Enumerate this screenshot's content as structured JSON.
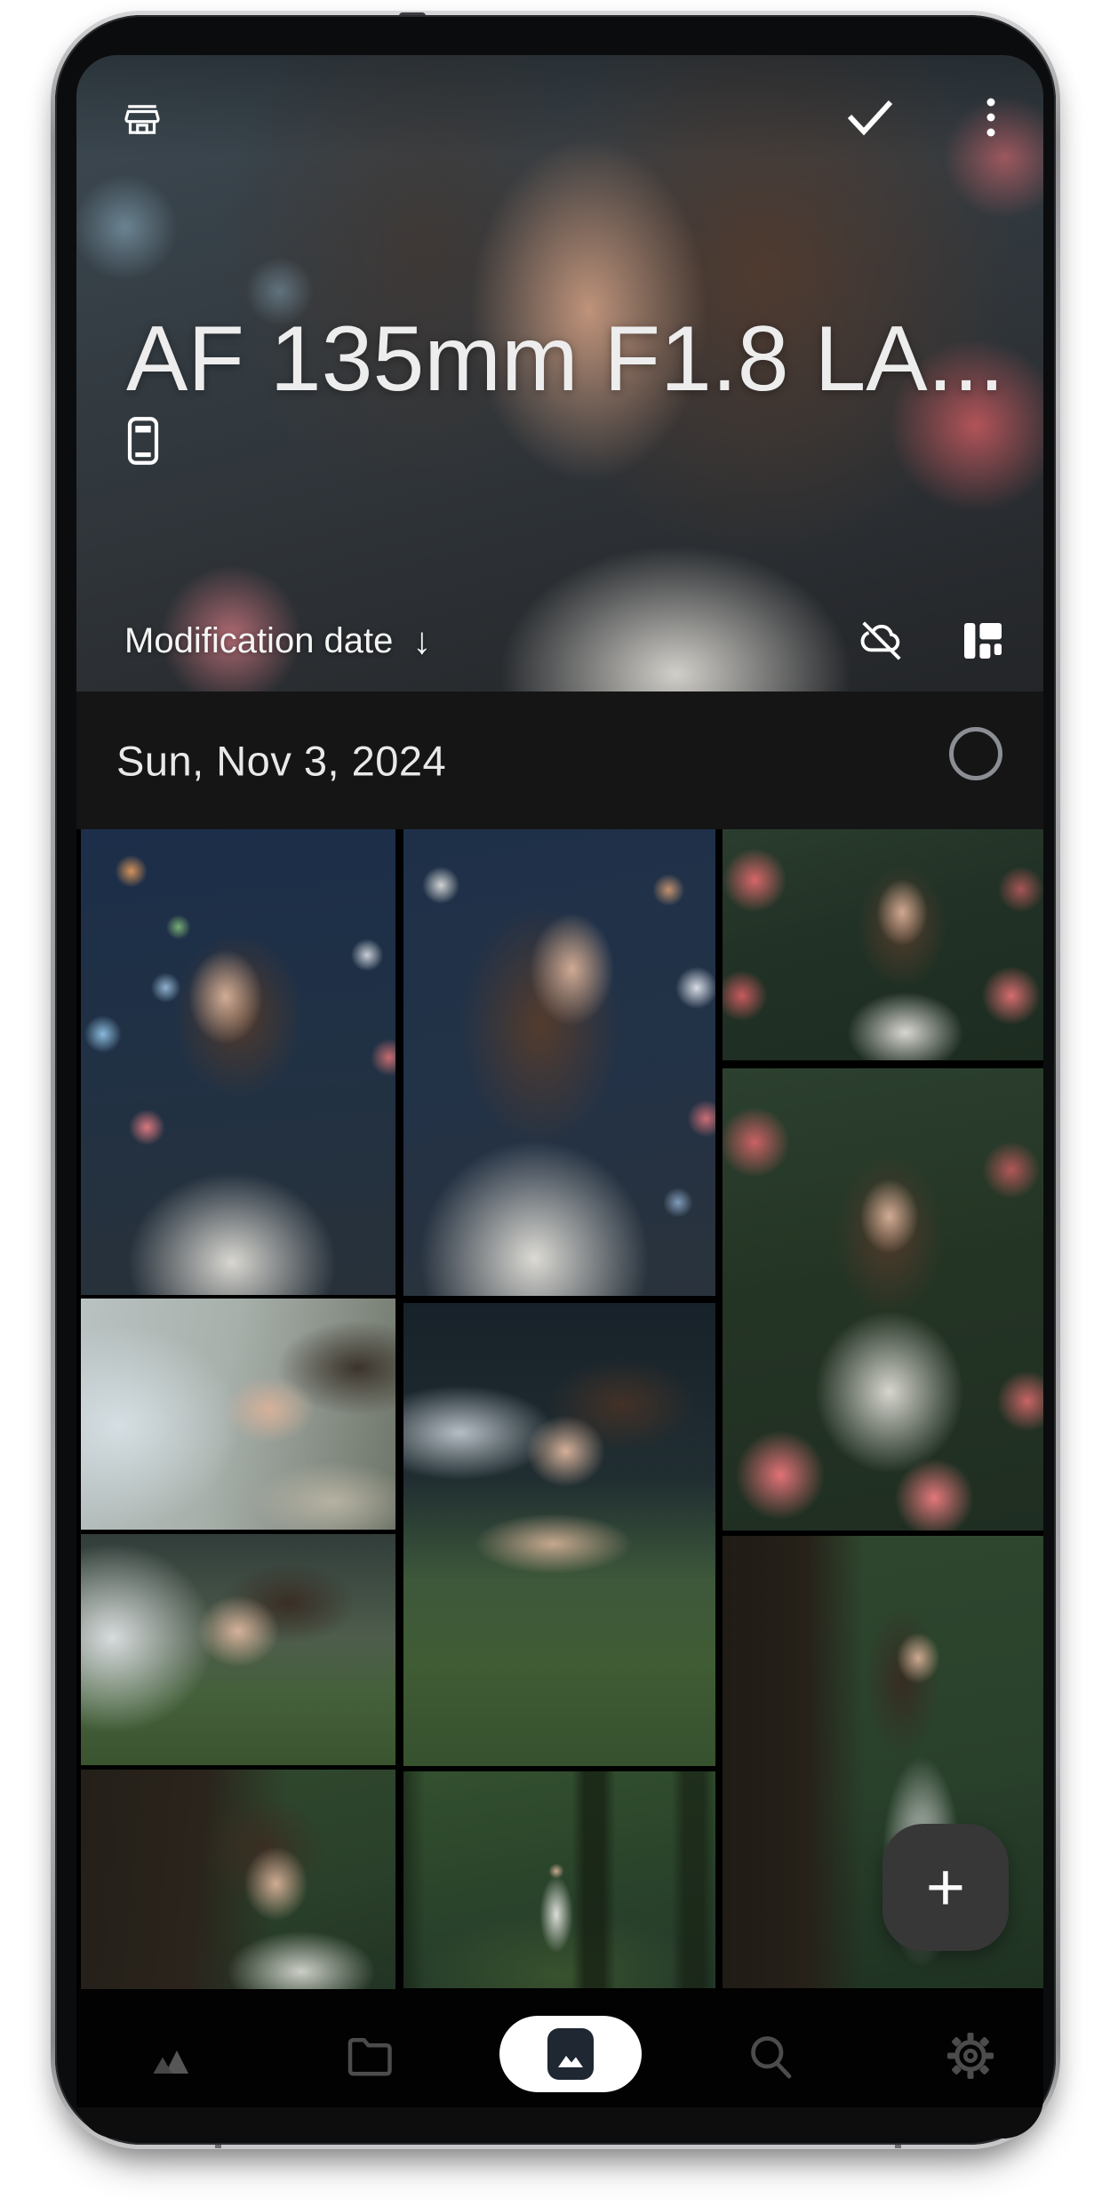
{
  "colors": {
    "page_bg": "#ffffff",
    "screen_bg": "#000000",
    "date_bar_bg": "#151515",
    "nav_bg": "#020202",
    "fab_bg": "#373737",
    "pill_bg": "#ffffff",
    "pill_inner": "#1e2732",
    "dim_icon": "#4c4c4c",
    "light_icon": "#ffffff",
    "circle_stroke": "#8b8e93",
    "title_text": "#ededed"
  },
  "header": {
    "title": "AF 135mm F1.8 LA...",
    "back_icon": "storefront-icon",
    "select_all_icon": "check-icon",
    "overflow_icon": "kebab-menu-icon",
    "storage_icon": "smartphone-icon",
    "sort": {
      "label": "Modification date",
      "direction_glyph": "↓",
      "cloud_icon": "cloud-off-icon",
      "layout_icon": "mosaic-layout-icon"
    }
  },
  "date_section": {
    "label": "Sun, Nov 3, 2024",
    "selection_state": "unselected"
  },
  "grid": {
    "photos": [
      {
        "desc": "night bokeh portrait, woman in white top"
      },
      {
        "desc": "night bokeh portrait, profile with long hair"
      },
      {
        "desc": "portrait among pink flowers, looking at camera"
      },
      {
        "desc": "tall portrait surrounded by pink flowers"
      },
      {
        "desc": "lying portrait, face upside down, pale dress"
      },
      {
        "desc": "lying with head resting on grass"
      },
      {
        "desc": "lying on grass, arms under chin"
      },
      {
        "desc": "profile beside dark tree bark"
      },
      {
        "desc": "standing in forest clearing, white dress"
      },
      {
        "desc": "leaning against tree trunk, long white dress"
      }
    ]
  },
  "fab": {
    "plus_glyph": "+"
  },
  "bottom_nav": {
    "items": [
      {
        "name": "collection",
        "icon": "mountains-icon",
        "active": false
      },
      {
        "name": "albums",
        "icon": "folder-icon",
        "active": false
      },
      {
        "name": "gallery",
        "icon": "photo-frame-icon",
        "active": true
      },
      {
        "name": "search",
        "icon": "magnifier-icon",
        "active": false
      },
      {
        "name": "settings",
        "icon": "gear-icon",
        "active": false
      }
    ]
  }
}
